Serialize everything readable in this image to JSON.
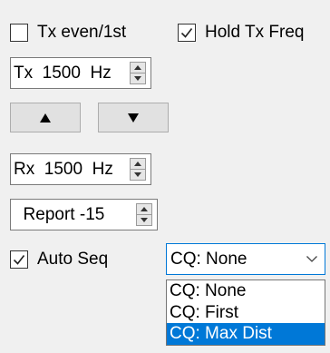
{
  "checkboxes": {
    "tx_even": {
      "label": "Tx even/1st",
      "checked": false
    },
    "hold_tx_freq": {
      "label": "Hold Tx Freq",
      "checked": true
    },
    "auto_seq": {
      "label": "Auto Seq",
      "checked": true
    }
  },
  "tx_freq": {
    "label": "Tx  1500  Hz"
  },
  "rx_freq": {
    "label": "Rx  1500  Hz"
  },
  "report": {
    "label": "  Report -15"
  },
  "arrows": {
    "up_icon": "up-triangle-icon",
    "down_icon": "down-triangle-icon"
  },
  "cq_combo": {
    "selected": "CQ: None",
    "options": [
      "CQ: None",
      "CQ: First",
      "CQ: Max Dist"
    ],
    "highlighted_index": 2
  },
  "colors": {
    "background": "#f0f0f0",
    "highlight": "#0078d7",
    "button_face": "#e1e1e1"
  }
}
